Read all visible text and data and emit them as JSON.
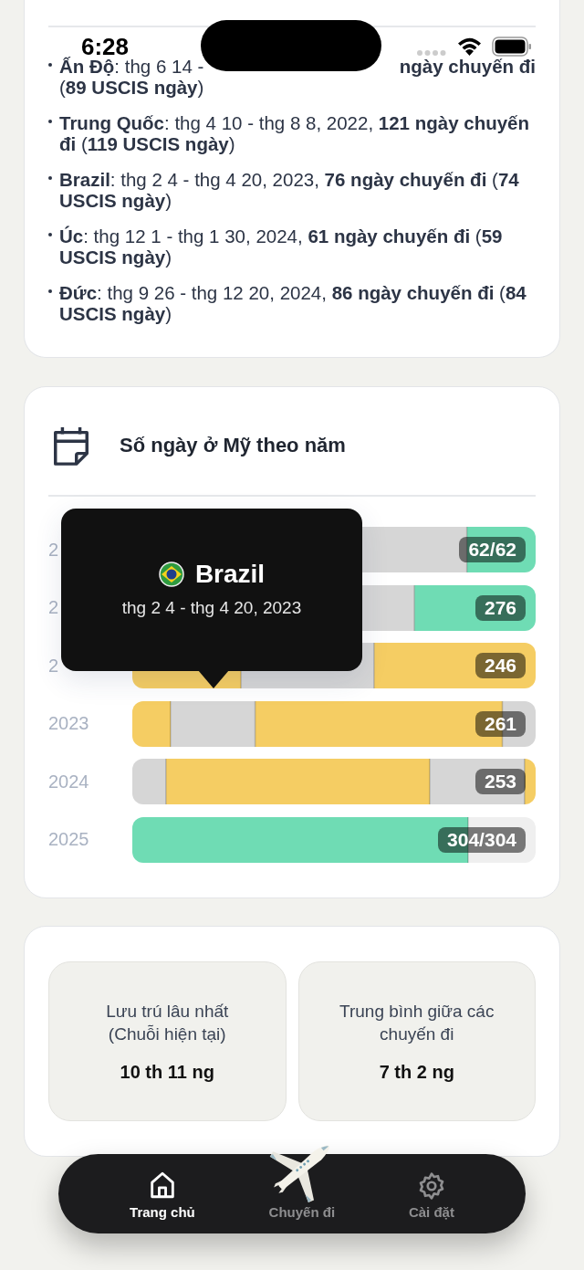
{
  "status_bar": {
    "time": "6:28"
  },
  "trips": {
    "items": [
      {
        "kind": "occluded",
        "before": "**Ấn Độ**: thg 6 14 -",
        "after": "**ngày chuyến đi**",
        "rest": "(**89 USCIS ngày**)"
      },
      {
        "kind": "full",
        "text": "**Trung Quốc**: thg 4 10 - thg 8 8, 2022, **121 ngày chuyến đi** (**119 USCIS ngày**)"
      },
      {
        "kind": "full",
        "text": "**Brazil**: thg 2 4 - thg 4 20, 2023, **76 ngày chuyến đi** (**74 USCIS ngày**)"
      },
      {
        "kind": "full",
        "text": "**Úc**: thg 12 1 - thg 1 30, 2024, **61 ngày chuyến đi** (**59 USCIS ngày**)"
      },
      {
        "kind": "full",
        "text": "**Đức**: thg 9 26 - thg 12 20, 2024, **86 ngày chuyến đi** (**84 USCIS ngày**)"
      }
    ]
  },
  "chart": {
    "title": "Số ngày ở Mỹ theo năm",
    "rows": [
      {
        "year": "2",
        "label": "62/62"
      },
      {
        "year": "2",
        "label": "276"
      },
      {
        "year": "2",
        "label": "246"
      },
      {
        "year": "2023",
        "label": "261"
      },
      {
        "year": "2024",
        "label": "253"
      },
      {
        "year": "2025",
        "label": "304/304"
      }
    ],
    "tooltip": {
      "title": "Brazil",
      "subtitle": "thg 2 4 - thg 4 20, 2023"
    }
  },
  "stats": [
    {
      "label": "Lưu trú lâu nhất (Chuỗi hiện tại)",
      "value": "10 th 11 ng"
    },
    {
      "label": "Trung bình giữa các chuyến đi",
      "value": "7 th 2 ng"
    }
  ],
  "nav": [
    {
      "label": "Trang chủ",
      "kind": "home",
      "selected": true
    },
    {
      "label": "Chuyến đi",
      "kind": "trips",
      "selected": false
    },
    {
      "label": "Cài đặt",
      "kind": "settings",
      "selected": false
    }
  ]
}
